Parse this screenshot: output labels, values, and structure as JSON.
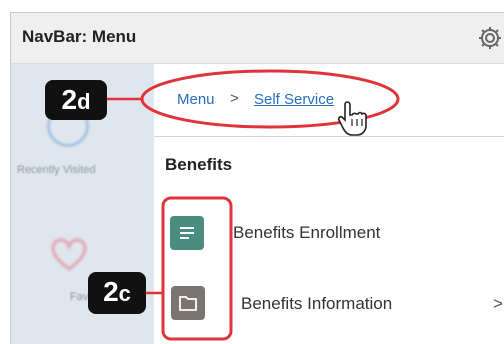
{
  "navbar": {
    "title": "NavBar: Menu",
    "gear_icon": "gear-icon"
  },
  "background_tiles": {
    "recent_label": "Recently Visited",
    "favorites_label": "Favorites"
  },
  "breadcrumb": {
    "root": "Menu",
    "separator": ">",
    "current": "Self Service"
  },
  "section": {
    "heading": "Benefits",
    "items": [
      {
        "label": "Benefits Enrollment",
        "icon": "list-icon",
        "color": "#4a8c7e"
      },
      {
        "label": "Benefits Information",
        "icon": "folder-icon",
        "color": "#7a7570",
        "chevron": ">"
      }
    ]
  },
  "callouts": {
    "step_2d": {
      "num": "2",
      "letter": "d"
    },
    "step_2c": {
      "num": "2",
      "letter": "c"
    }
  },
  "colors": {
    "highlight": "#e0333a",
    "link": "#2a6ebb"
  }
}
